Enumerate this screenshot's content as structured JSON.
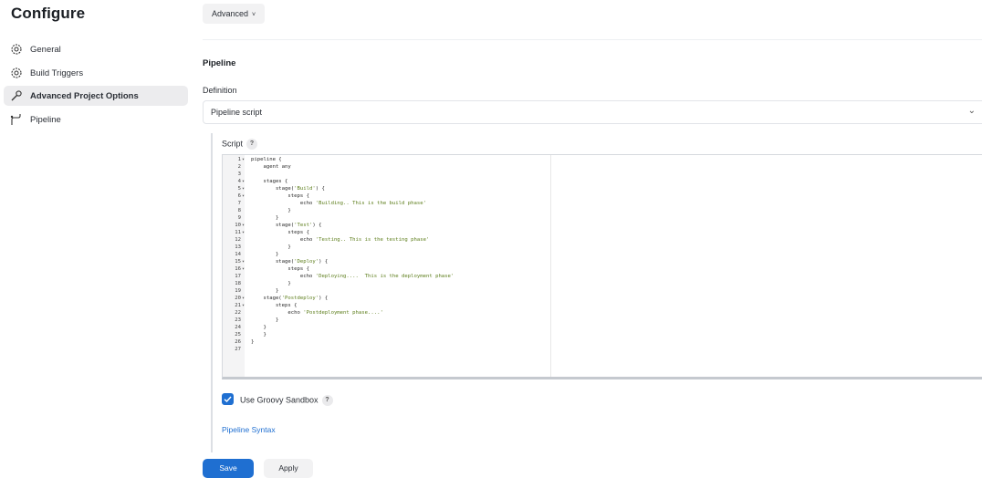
{
  "sidebar": {
    "title": "Configure",
    "items": [
      {
        "label": "General",
        "icon": "gear-icon"
      },
      {
        "label": "Build Triggers",
        "icon": "gear-icon"
      },
      {
        "label": "Advanced Project Options",
        "icon": "wrench-icon"
      },
      {
        "label": "Pipeline",
        "icon": "pipeline-icon"
      }
    ]
  },
  "main": {
    "advanced_button": "Advanced",
    "section_title": "Pipeline",
    "definition_label": "Definition",
    "definition_value": "Pipeline script",
    "script_label": "Script",
    "help_text": "?",
    "sandbox_label": "Use Groovy Sandbox",
    "syntax_link": "Pipeline Syntax",
    "save_label": "Save",
    "apply_label": "Apply"
  },
  "editor": {
    "lines": [
      "pipeline {",
      "    agent any",
      "",
      "    stages {",
      "        stage('Build') {",
      "            steps {",
      "                echo 'Building.. This is the build phase'",
      "            }",
      "        }",
      "        stage('Test') {",
      "            steps {",
      "                echo 'Testing.. This is the testing phase'",
      "            }",
      "        }",
      "        stage('Deploy') {",
      "            steps {",
      "                echo 'Deploying....  This is the deployment phase'",
      "            }",
      "        }",
      "    stage('Postdeploy') {",
      "        steps {",
      "            echo 'Postdeployment phase....'",
      "        }",
      "    }",
      "    }",
      "}",
      ""
    ],
    "folds": [
      1,
      4,
      5,
      6,
      10,
      11,
      15,
      16,
      20,
      21
    ]
  },
  "colors": {
    "accent": "#1f6fd1",
    "string": "#5c7d1a"
  }
}
